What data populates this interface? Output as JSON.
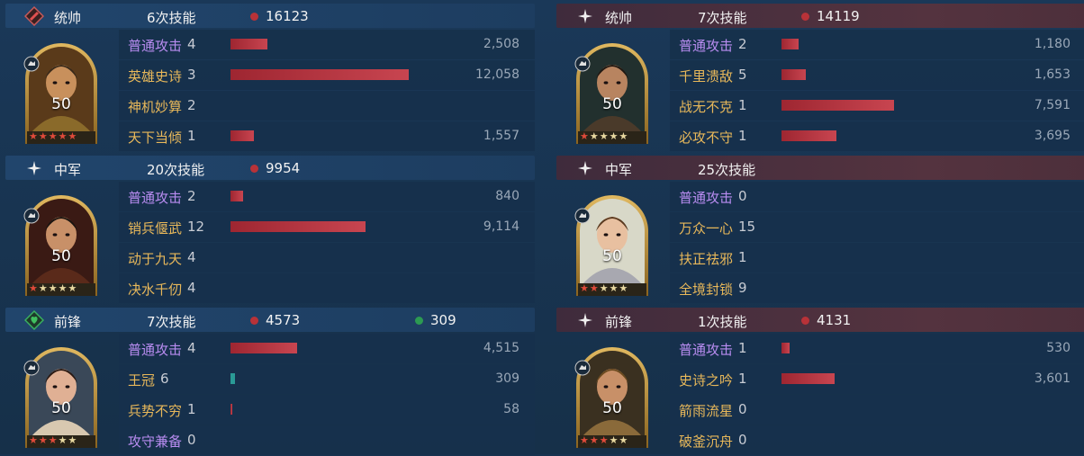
{
  "colors": {
    "panel_bg": "#173250",
    "left_header": "#21456c",
    "right_header": "#54333f",
    "basic_attack": "#b88cf0",
    "skill_name": "#e8b85a",
    "damage_bar": "#b83238",
    "heal_bar": "#2a9a96"
  },
  "left": [
    {
      "role": "统帅",
      "role_icon": "red-flag-icon",
      "skill_count": "6次技能",
      "damage": "16123",
      "heal": null,
      "hero": {
        "level": "50",
        "stars_red": 5,
        "stars_total": 5,
        "type_icon": "cavalry-icon",
        "art": "bearded-general-golden-helmet"
      },
      "skills": [
        {
          "name": "普通攻击",
          "kind": "basic",
          "times": "4",
          "value": "2,508",
          "bar_fraction": 0.208
        },
        {
          "name": "英雄史诗",
          "kind": "skill",
          "times": "3",
          "value": "12,058",
          "bar_fraction": 1.0
        },
        {
          "name": "神机妙算",
          "kind": "skill",
          "times": "2",
          "value": "",
          "bar_fraction": 0
        },
        {
          "name": "天下当倾",
          "kind": "skill",
          "times": "1",
          "value": "1,557",
          "bar_fraction": 0.129
        }
      ]
    },
    {
      "role": "中军",
      "role_icon": "sparkle-icon",
      "skill_count": "20次技能",
      "damage": "9954",
      "heal": null,
      "hero": {
        "level": "50",
        "stars_red": 1,
        "stars_total": 5,
        "type_icon": "sword-icon",
        "art": "emperor-dark-robe"
      },
      "skills": [
        {
          "name": "普通攻击",
          "kind": "basic",
          "times": "2",
          "value": "840",
          "bar_fraction": 0.07
        },
        {
          "name": "销兵偃武",
          "kind": "skill",
          "times": "12",
          "value": "9,114",
          "bar_fraction": 0.756
        },
        {
          "name": "动于九天",
          "kind": "skill",
          "times": "4",
          "value": "",
          "bar_fraction": 0
        },
        {
          "name": "决水千仞",
          "kind": "skill",
          "times": "4",
          "value": "",
          "bar_fraction": 0
        }
      ]
    },
    {
      "role": "前锋",
      "role_icon": "green-heart-icon",
      "skill_count": "7次技能",
      "damage": "4573",
      "heal": "309",
      "hero": {
        "level": "50",
        "stars_red": 3,
        "stars_total": 5,
        "type_icon": "cavalry-icon",
        "art": "empress-with-crown"
      },
      "skills": [
        {
          "name": "普通攻击",
          "kind": "basic",
          "times": "4",
          "value": "4,515",
          "bar_fraction": 0.374,
          "bar_color": "red"
        },
        {
          "name": "王冠",
          "kind": "skill",
          "times": "6",
          "value": "309",
          "bar_fraction": 0.026,
          "bar_color": "teal"
        },
        {
          "name": "兵势不穷",
          "kind": "skill",
          "times": "1",
          "value": "58",
          "bar_fraction": 0.005,
          "bar_color": "red"
        },
        {
          "name": "攻守兼备",
          "kind": "basic",
          "times": "0",
          "value": "",
          "bar_fraction": 0
        }
      ]
    }
  ],
  "right": [
    {
      "role": "统帅",
      "role_icon": "sparkle-icon",
      "skill_count": "7次技能",
      "damage": "14119",
      "heal": null,
      "hero": {
        "level": "50",
        "stars_red": 1,
        "stars_total": 5,
        "type_icon": "cavalry-icon",
        "art": "bearded-warrior-dark"
      },
      "skills": [
        {
          "name": "普通攻击",
          "kind": "basic",
          "times": "2",
          "value": "1,180",
          "bar_fraction": 0.098
        },
        {
          "name": "千里溃敌",
          "kind": "skill",
          "times": "5",
          "value": "1,653",
          "bar_fraction": 0.137
        },
        {
          "name": "战无不克",
          "kind": "skill",
          "times": "1",
          "value": "7,591",
          "bar_fraction": 0.63
        },
        {
          "name": "必攻不守",
          "kind": "skill",
          "times": "1",
          "value": "3,695",
          "bar_fraction": 0.306
        }
      ]
    },
    {
      "role": "中军",
      "role_icon": "sparkle-icon",
      "skill_count": "25次技能",
      "damage": null,
      "heal": null,
      "hero": {
        "level": "50",
        "stars_red": 2,
        "stars_total": 5,
        "type_icon": "shield-icon",
        "art": "young-knight-armor"
      },
      "skills": [
        {
          "name": "普通攻击",
          "kind": "basic",
          "times": "0",
          "value": "",
          "bar_fraction": 0
        },
        {
          "name": "万众一心",
          "kind": "skill",
          "times": "15",
          "value": "",
          "bar_fraction": 0
        },
        {
          "name": "扶正祛邪",
          "kind": "skill",
          "times": "1",
          "value": "",
          "bar_fraction": 0
        },
        {
          "name": "全境封锁",
          "kind": "skill",
          "times": "9",
          "value": "",
          "bar_fraction": 0
        }
      ]
    },
    {
      "role": "前锋",
      "role_icon": "sparkle-icon",
      "skill_count": "1次技能",
      "damage": "4131",
      "heal": null,
      "hero": {
        "level": "50",
        "stars_red": 3,
        "stars_total": 5,
        "type_icon": "cavalry-icon",
        "art": "king-with-crown"
      },
      "skills": [
        {
          "name": "普通攻击",
          "kind": "basic",
          "times": "1",
          "value": "530",
          "bar_fraction": 0.044
        },
        {
          "name": "史诗之吟",
          "kind": "skill",
          "times": "1",
          "value": "3,601",
          "bar_fraction": 0.299
        },
        {
          "name": "箭雨流星",
          "kind": "skill",
          "times": "0",
          "value": "",
          "bar_fraction": 0
        },
        {
          "name": "破釜沉舟",
          "kind": "skill",
          "times": "0",
          "value": "",
          "bar_fraction": 0
        }
      ]
    }
  ]
}
